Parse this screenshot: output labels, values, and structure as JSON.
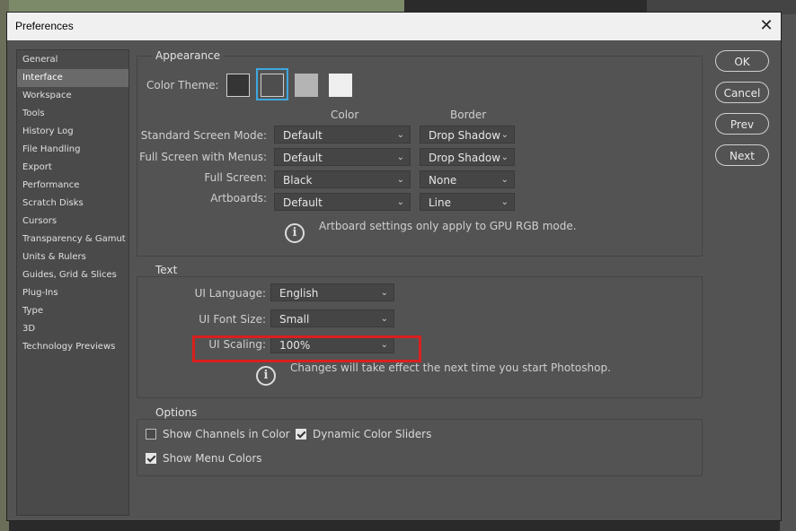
{
  "dialog": {
    "title": "Preferences"
  },
  "sidebar": {
    "items": [
      {
        "label": "General"
      },
      {
        "label": "Interface"
      },
      {
        "label": "Workspace"
      },
      {
        "label": "Tools"
      },
      {
        "label": "History Log"
      },
      {
        "label": "File Handling"
      },
      {
        "label": "Export"
      },
      {
        "label": "Performance"
      },
      {
        "label": "Scratch Disks"
      },
      {
        "label": "Cursors"
      },
      {
        "label": "Transparency & Gamut"
      },
      {
        "label": "Units & Rulers"
      },
      {
        "label": "Guides, Grid & Slices"
      },
      {
        "label": "Plug-Ins"
      },
      {
        "label": "Type"
      },
      {
        "label": "3D"
      },
      {
        "label": "Technology Previews"
      }
    ],
    "active": "Interface"
  },
  "appearance": {
    "title": "Appearance",
    "color_theme_label": "Color Theme:",
    "themes": [
      {
        "color": "#353535"
      },
      {
        "color": "#4e4e4e",
        "selected": true
      },
      {
        "color": "#b4b4b4"
      },
      {
        "color": "#efefef"
      }
    ],
    "col_color": "Color",
    "col_border": "Border",
    "rows": [
      {
        "label": "Standard Screen Mode:",
        "color": "Default",
        "border": "Drop Shadow"
      },
      {
        "label": "Full Screen with Menus:",
        "color": "Default",
        "border": "Drop Shadow"
      },
      {
        "label": "Full Screen:",
        "color": "Black",
        "border": "None"
      },
      {
        "label": "Artboards:",
        "color": "Default",
        "border": "Line"
      }
    ],
    "note": "Artboard settings only apply to GPU RGB mode."
  },
  "text_group": {
    "title": "Text",
    "ui_language_label": "UI Language:",
    "ui_language_value": "English",
    "ui_font_size_label": "UI Font Size:",
    "ui_font_size_value": "Small",
    "ui_scaling_label": "UI Scaling:",
    "ui_scaling_value": "100%",
    "note": "Changes will take effect the next time you start Photoshop."
  },
  "options": {
    "title": "Options",
    "show_channels_in_color": {
      "label": "Show Channels in Color",
      "checked": false
    },
    "dynamic_color_sliders": {
      "label": "Dynamic Color Sliders",
      "checked": true
    },
    "show_menu_colors": {
      "label": "Show Menu Colors",
      "checked": true
    }
  },
  "buttons": {
    "ok": "OK",
    "cancel": "Cancel",
    "prev": "Prev",
    "next": "Next"
  },
  "colors": {
    "highlight": "#d9201f",
    "selected_theme_border": "#3ea8e0"
  }
}
